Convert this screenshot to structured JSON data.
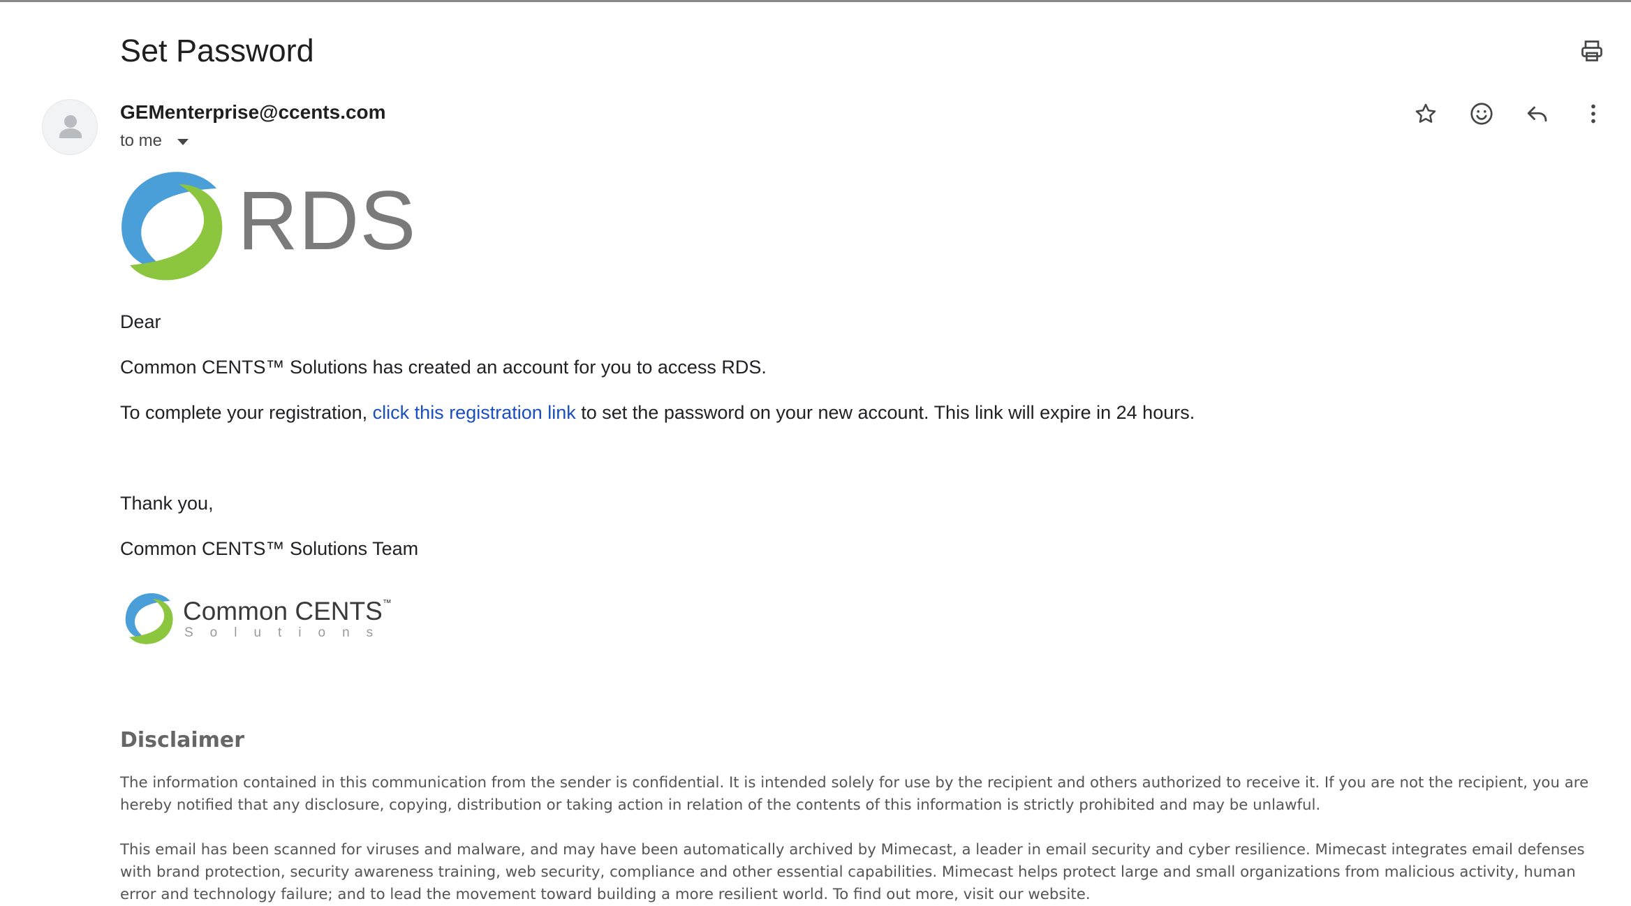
{
  "email": {
    "subject": "Set Password",
    "sender": "GEMenterprise@ccents.com",
    "recipient": "to me"
  },
  "icons": {
    "print": "printer-icon",
    "star": "star-icon",
    "emoji": "smiley-icon",
    "reply": "reply-icon",
    "more": "more-vertical-icon",
    "avatar": "person-icon"
  },
  "body": {
    "logo_text": "RDS",
    "greeting": "Dear",
    "line1": "Common CENTS™ Solutions has created an account for you to access RDS.",
    "line2_before": "To complete your registration, ",
    "line2_link": "click this registration link",
    "line2_after": " to set the password on your new account. This link will expire in 24 hours.",
    "thanks": "Thank you,",
    "signature": "Common CENTS™ Solutions Team",
    "company_logo_name": "Common CENTS",
    "company_logo_tm": "™",
    "company_logo_sub": "Solutions"
  },
  "disclaimer": {
    "title": "Disclaimer",
    "paragraph1": "The information contained in this communication from the sender is confidential. It is intended solely for use by the recipient and others authorized to receive it. If you are not the recipient, you are hereby notified that any disclosure, copying, distribution or taking action in relation of the contents of this information is strictly prohibited and may be unlawful.",
    "paragraph2": "This email has been scanned for viruses and malware, and may have been automatically archived by Mimecast, a leader in email security and cyber resilience. Mimecast integrates email defenses with brand protection, security awareness training, web security, compliance and other essential capabilities. Mimecast helps protect large and small organizations from malicious activity, human error and technology failure; and to lead the movement toward building a more resilient world. To find out more, visit our website."
  },
  "colors": {
    "link": "#1a4fc0",
    "logo_blue": "#4a9fd8",
    "logo_green": "#8cc63f",
    "logo_gray": "#7a7a7a"
  }
}
